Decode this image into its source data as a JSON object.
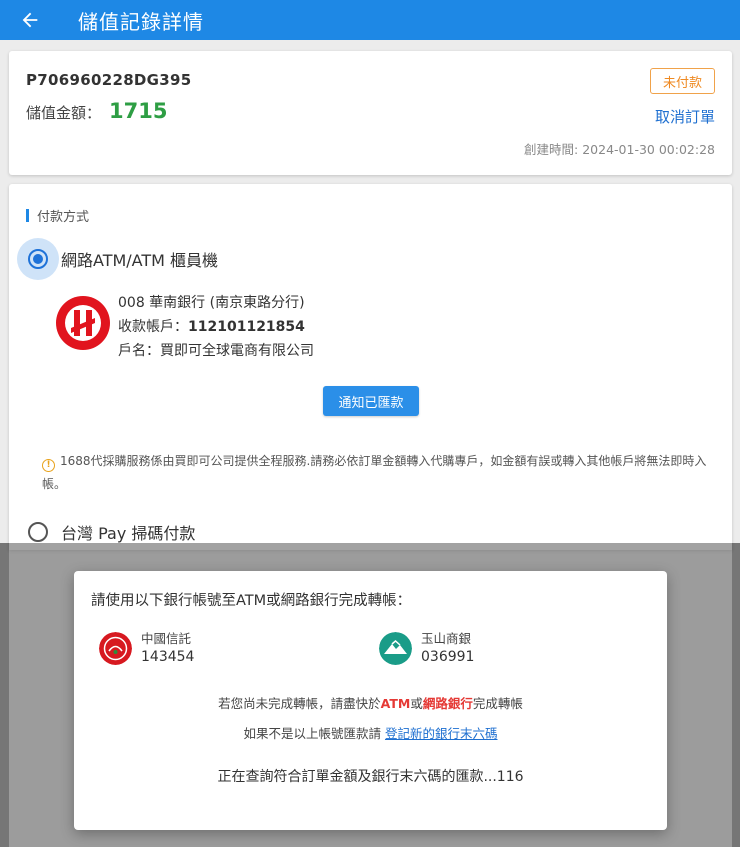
{
  "header": {
    "title": "儲值記錄詳情"
  },
  "order": {
    "id": "P706960228DG395",
    "amount_label": "儲值金額：",
    "amount": "1715",
    "status": "未付款",
    "cancel_label": "取消訂單",
    "created": "創建時間: 2024-01-30 00:02:28"
  },
  "payment": {
    "section_title": "付款方式",
    "options": [
      {
        "label": "網路ATM/ATM 櫃員機",
        "selected": true
      },
      {
        "label": "台灣 Pay 掃碼付款",
        "selected": false
      }
    ],
    "bank": {
      "name": "008 華南銀行 (南京東路分行)",
      "account_label": "收款帳戶：",
      "account": "112101121854",
      "holder": "戶名：買即可全球電商有限公司"
    },
    "notify_label": "通知已匯款",
    "warning": "1688代採購服務係由買即可公司提供全程服務.請務必依訂單金額轉入代購專戶，如金額有誤或轉入其他帳戶將無法即時入帳。"
  },
  "dialog": {
    "title": "請使用以下銀行帳號至ATM或網路銀行完成轉帳：",
    "banks": [
      {
        "name": "中國信託",
        "code": "143454"
      },
      {
        "name": "玉山商銀",
        "code": "036991"
      }
    ],
    "hint_prefix": "若您尚未完成轉帳，請盡快於",
    "hint_atm": "ATM",
    "hint_or": "或",
    "hint_online": "網路銀行",
    "hint_suffix": "完成轉帳",
    "register_prefix": "如果不是以上帳號匯款請",
    "register_link": "登記新的銀行末六碼",
    "status": "正在查詢符合訂單金額及銀行末六碼的匯款...116"
  },
  "colors": {
    "primary": "#1e88e5",
    "amount": "#2e9e44",
    "status": "#ef8a22",
    "emphasis": "#e53935"
  }
}
